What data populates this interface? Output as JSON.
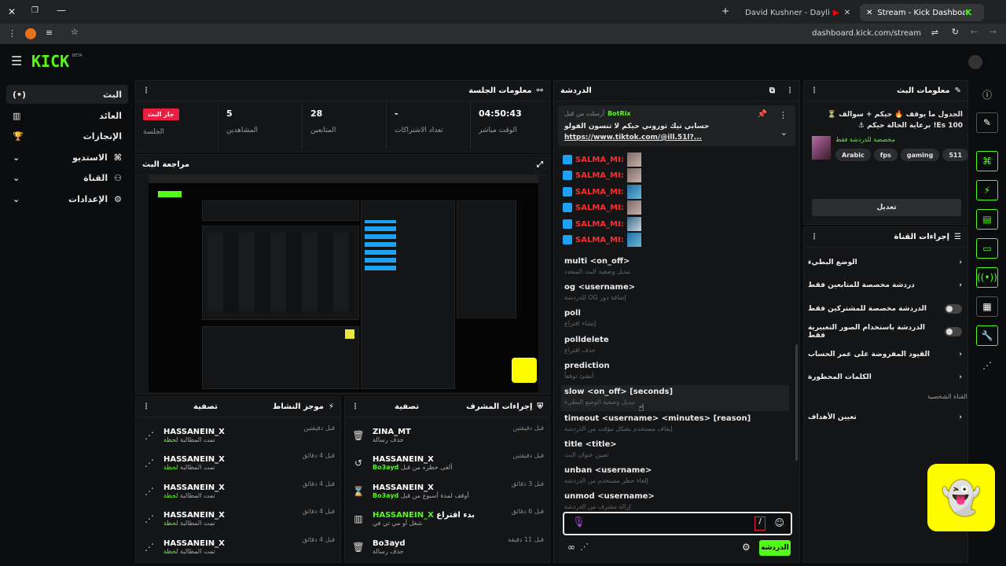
{
  "browser": {
    "tabs": [
      {
        "label": "David Kushner - Daylight (Lyric"
      },
      {
        "label": "Stream - Kick Dashboard"
      }
    ],
    "url": "dashboard.kick.com/stream"
  },
  "app": {
    "logo": "KICK",
    "logo_sup": "BETA"
  },
  "sidebar": {
    "items": [
      {
        "label": "البث"
      },
      {
        "label": "العائد"
      },
      {
        "label": "الإنجازات"
      },
      {
        "label": "الاستديو"
      },
      {
        "label": "القناة"
      },
      {
        "label": "الإعدادات"
      }
    ]
  },
  "session": {
    "title": "معلومات الجلسة",
    "live_badge": "جار البث",
    "live_label": "الجلسة",
    "viewers": "5",
    "viewers_label": "المشاهدين",
    "followers": "28",
    "followers_label": "المتابعين",
    "subs": "-",
    "subs_label": "تعداد الاشتراكات",
    "time": "04:50:43",
    "time_label": "الوقت مباشر"
  },
  "preview": {
    "title": "مراجعة البث"
  },
  "activity": {
    "title": "موجز النشاط",
    "filter": "تصفية",
    "items": [
      {
        "name": "HASSANEIN_X",
        "sub": "تمت المطالبة",
        "sub2": "لحظة",
        "time": "قبل دقيقتين"
      },
      {
        "name": "HASSANEIN_X",
        "sub": "تمت المطالبة",
        "sub2": "لحظة",
        "time": "قبل 4 دقائق"
      },
      {
        "name": "HASSANEIN_X",
        "sub": "تمت المطالبة",
        "sub2": "لحظة",
        "time": "قبل 4 دقائق"
      },
      {
        "name": "HASSANEIN_X",
        "sub": "تمت المطالبة",
        "sub2": "لحظة",
        "time": "قبل 4 دقائق"
      },
      {
        "name": "HASSANEIN_X",
        "sub": "تمت المطالبة",
        "sub2": "لحظة",
        "time": "قبل 4 دقائق"
      }
    ]
  },
  "modactions": {
    "title": "إجراءات المشرف",
    "filter": "تصفية",
    "items": [
      {
        "name": "ZINA_MT",
        "sub": "حذف رسالة",
        "time": "قبل دقيقتين",
        "icon": "trash-icon"
      },
      {
        "name": "HASSANEIN_X",
        "sub": "ألغى حظره من قبل",
        "by": "Bo3ayd",
        "time": "قبل دقيقتين",
        "icon": "undo-icon"
      },
      {
        "name": "HASSANEIN_X",
        "sub": "أوقف لمدة أسبوع من قبل",
        "by": "Bo3ayd",
        "time": "قبل 3 دقائق",
        "icon": "hourglass-icon"
      },
      {
        "name": "HASSANEIN_X",
        "extra": "بدء اقتراع",
        "sub": "شغل أو مي تي في",
        "time": "قبل 6 دقائق",
        "icon": "poll-icon"
      },
      {
        "name": "Bo3ayd",
        "sub": "حذف رسالة",
        "time": "قبل 11 دقيقة",
        "icon": "trash-icon"
      }
    ]
  },
  "chat": {
    "title": "الدردشة",
    "pinned_by": "أرسلت من قبل",
    "pinned_user": "BotRix",
    "pinned_text": "حسابي تيك توروني حيكم لا تنسون الفولو",
    "pinned_link": "https://www.tiktok.com/@ill.51l?...",
    "user": "SALMA_MI:",
    "commands": [
      {
        "cmd": "multi <on_off>",
        "desc": "تبديل وضعية البث المتعدد"
      },
      {
        "cmd": "og <username>",
        "desc": "للدردشة OG إضافة دور"
      },
      {
        "cmd": "poll",
        "desc": "إنشاء اقتراع"
      },
      {
        "cmd": "polldelete",
        "desc": "حذف اقتراع"
      },
      {
        "cmd": "prediction",
        "desc": "أنشئ توقعاً"
      },
      {
        "cmd": "slow <on_off> [seconds]",
        "desc": "تبديل وضعية الوضع البطيء"
      },
      {
        "cmd": "timeout <username> <minutes> [reason]",
        "desc": "إيقاف مستخدم بشكل مؤقت من الدردشة"
      },
      {
        "cmd": "title <title>",
        "desc": "تعيين عنوان البث"
      },
      {
        "cmd": "unban <username>",
        "desc": "إلغاء حظر مستخدم من الدردشة"
      },
      {
        "cmd": "unmod <username>",
        "desc": "إزالة مشرف من الدردشة"
      }
    ],
    "input_value": "/",
    "send_label": "الدردشة"
  },
  "streaminfo": {
    "title": "معلومات البث",
    "stream_title": "الجدول ما يوقف 🔥 حيكم + سوالف ⏳ 100 Es! برعاية الخالة حيكم ⚓",
    "category": "مخصصة للدردشة فقط",
    "tags": [
      "Arabic",
      "fps",
      "gaming",
      "511"
    ],
    "edit_label": "تعديل"
  },
  "channelactions": {
    "title": "إجراءات القناة",
    "items": [
      {
        "label": "الوضع البطيء",
        "kind": "arrow"
      },
      {
        "label": "دردشة مخصصة للمتابعين فقط",
        "kind": "arrow"
      },
      {
        "label": "الدردشة مخصصة للمشتركين فقط",
        "kind": "toggle"
      },
      {
        "label": "الدردشة باستخدام الصور التعبيرية فقط",
        "kind": "toggle"
      },
      {
        "label": "القيود المفروضة على عمر الحساب",
        "kind": "arrow"
      },
      {
        "label": "الكلمات المحظورة",
        "kind": "arrow"
      }
    ],
    "section": "القناة الشخصية",
    "goals": "تعيين الأهداف"
  },
  "colors": {
    "accent": "#53fc18",
    "live": "#e91e40"
  }
}
